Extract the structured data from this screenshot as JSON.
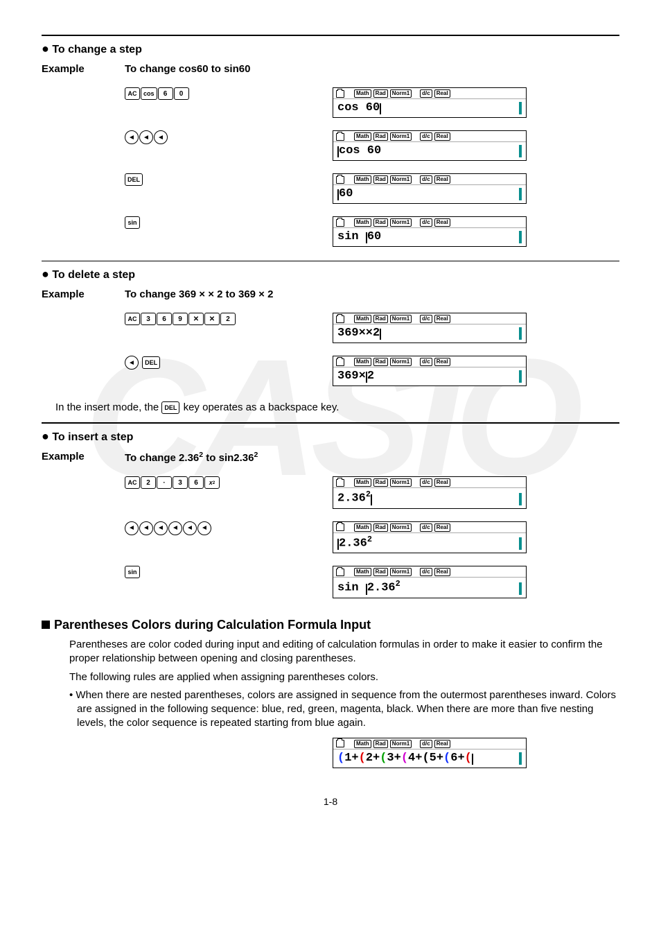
{
  "status": {
    "math": "Math",
    "rad": "Rad",
    "norm1": "Norm1",
    "dc": "d/c",
    "real": "Real"
  },
  "section1": {
    "heading": "To change a step",
    "example_label": "Example",
    "example_desc": "To change cos60 to sin60",
    "steps": [
      {
        "keys": [
          "AC",
          "cos",
          "6",
          "0"
        ],
        "screen": "cos 60",
        "cursor": "after"
      },
      {
        "keys": [
          "◄",
          "◄",
          "◄"
        ],
        "round": true,
        "screen": "cos 60",
        "cursor": "before"
      },
      {
        "keys": [
          "DEL"
        ],
        "screen": "60",
        "cursor": "before"
      },
      {
        "keys": [
          "sin"
        ],
        "screen": "sin 60",
        "cursor": "mid",
        "cursor_text_pre": "sin ",
        "cursor_text_post": "60"
      }
    ]
  },
  "section2": {
    "heading": "To delete a step",
    "example_label": "Example",
    "example_desc_pre": "To change 369 ",
    "example_desc_mid": " 2 to 369 ",
    "example_desc_post": " 2",
    "times": "×",
    "steps": [
      {
        "keys": [
          "AC",
          "3",
          "6",
          "9",
          "✕",
          "✕",
          "2"
        ],
        "screen": "369××2",
        "cursor": "after"
      },
      {
        "keys_groups": [
          [
            "◄"
          ],
          [
            "DEL"
          ]
        ],
        "round_first": true,
        "screen": "369×2",
        "cursor": "mid",
        "cursor_text_pre": "369×",
        "cursor_text_post": "2"
      }
    ],
    "note_pre": "In the insert mode, the ",
    "note_key": "DEL",
    "note_post": " key operates as a backspace key."
  },
  "section3": {
    "heading": "To insert a step",
    "example_label": "Example",
    "example_desc": "To change 2.36² to sin2.36²",
    "steps": [
      {
        "keys": [
          "AC",
          "2",
          "·",
          "3",
          "6",
          "x²"
        ],
        "screen_html": "2.36<sup>2</sup>",
        "cursor": "after"
      },
      {
        "keys": [
          "◄",
          "◄",
          "◄",
          "◄",
          "◄",
          "◄"
        ],
        "round": true,
        "screen_html": "2.36<sup>2</sup>",
        "cursor": "before"
      },
      {
        "keys": [
          "sin"
        ],
        "screen_html": "sin 2.36<sup>2</sup>",
        "cursor": "mid",
        "pre_html": "sin ",
        "post_html": "2.36<sup>2</sup>"
      }
    ]
  },
  "section4": {
    "heading": "Parentheses Colors during Calculation Formula Input",
    "p1": "Parentheses are color coded during input and editing of calculation formulas in order to make it easier to confirm the proper relationship between opening and closing parentheses.",
    "p2": "The following rules are applied when assigning parentheses colors.",
    "bullet": "When there are nested parentheses, colors are assigned in sequence from the outermost parentheses inward. Colors are assigned in the following sequence: blue, red, green, magenta, black. When there are more than five nesting levels, the color sequence is repeated starting from blue again.",
    "screen_expr": "(1+(2+(3+(4+(5+(6+("
  },
  "page_number": "1-8"
}
